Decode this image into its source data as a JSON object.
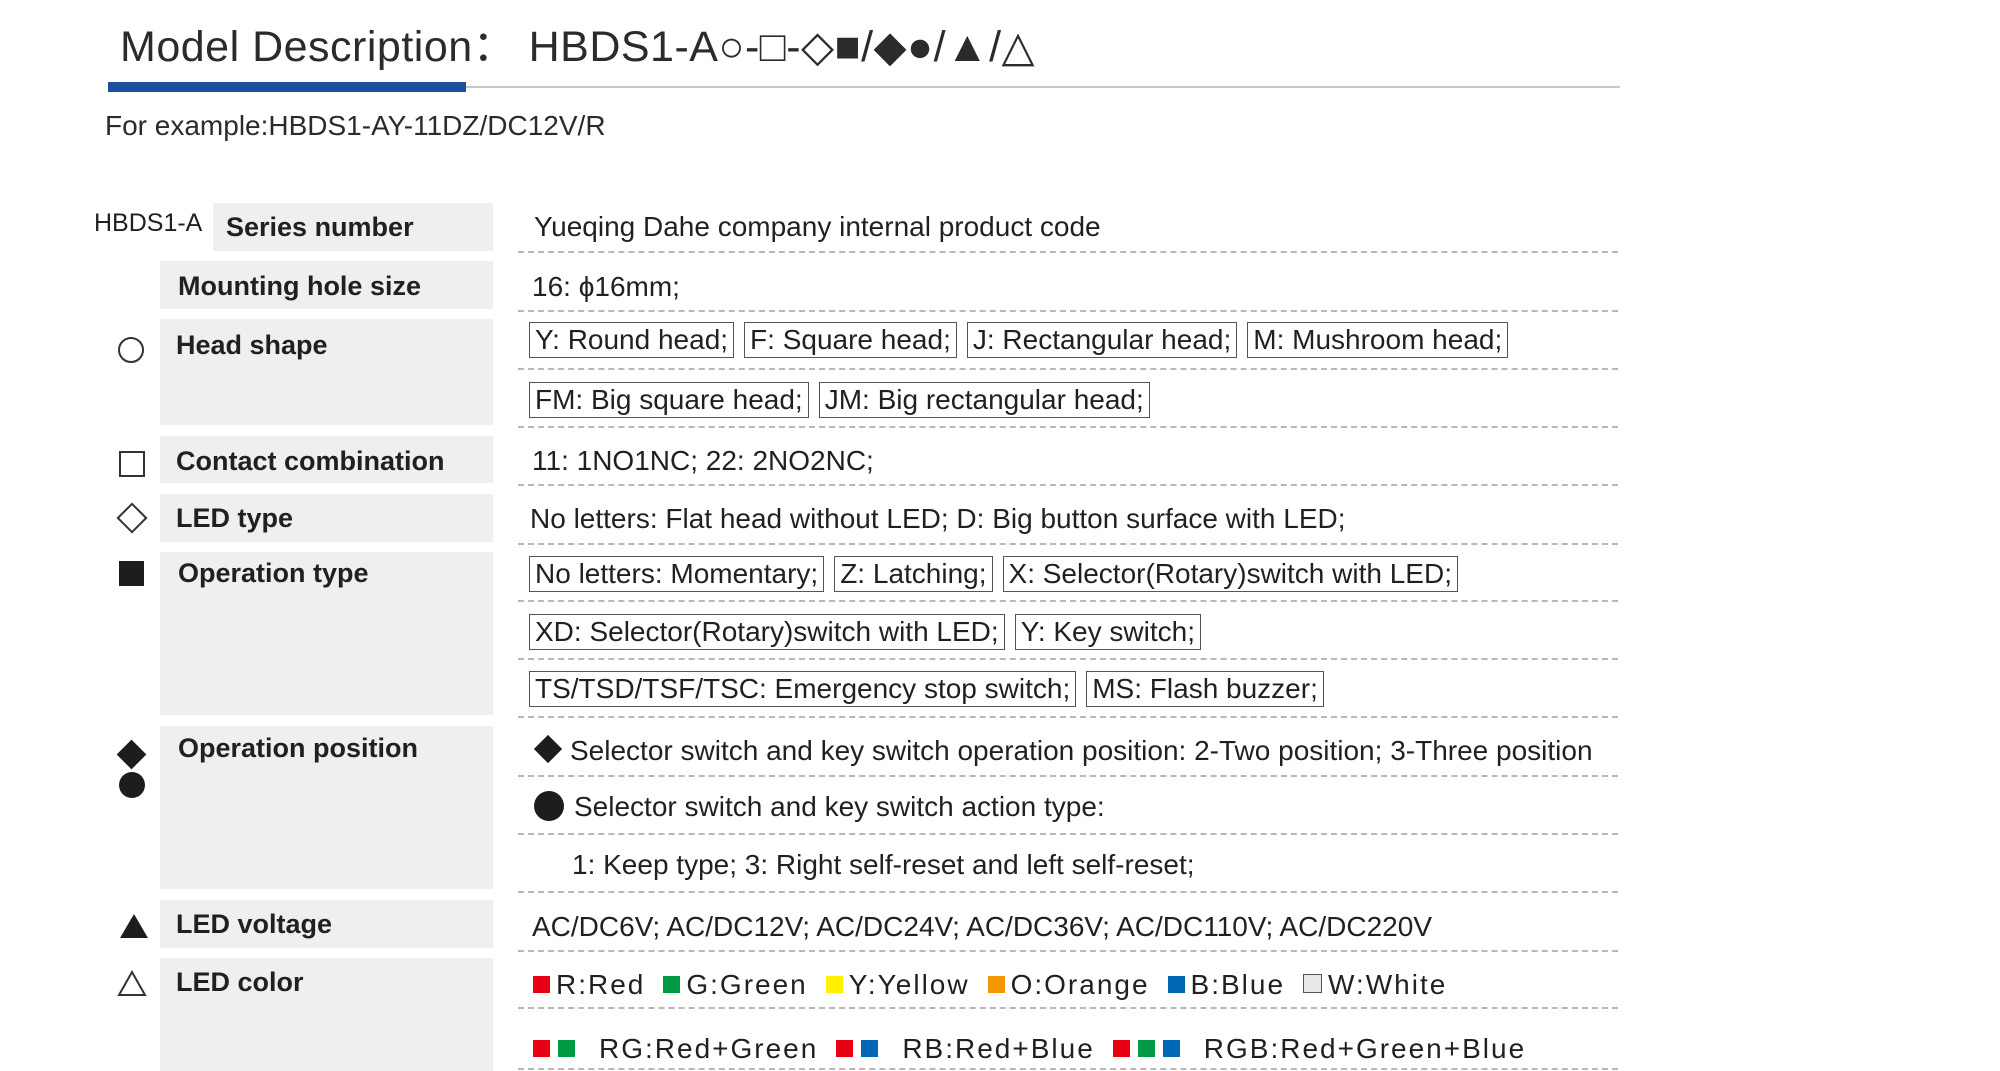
{
  "header": {
    "title": "Model Description： HBDS1-A○-□-◇■/◆●/▲/△",
    "example": "For example:HBDS1-AY-11DZ/DC12V/R"
  },
  "rows": {
    "series": {
      "code": "HBDS1-A",
      "label": "Series number",
      "value": "Yueqing Dahe company internal product code"
    },
    "mounting": {
      "label": "Mounting hole size",
      "value": "16: ϕ16mm;"
    },
    "head_shape": {
      "symbol_icon": "open-circle-icon",
      "label": "Head  shape",
      "line1": [
        "Y: Round head;",
        "F: Square head;",
        "J: Rectangular head;",
        "M: Mushroom head;"
      ],
      "line2": [
        "FM: Big square head;",
        "JM: Big rectangular head;"
      ]
    },
    "contact": {
      "symbol_icon": "open-square-icon",
      "label": "Contact combination",
      "value": "11: 1NO1NC;   22: 2NO2NC;"
    },
    "led_type": {
      "symbol_icon": "open-diamond-icon",
      "label": "LED type",
      "value": "No letters: Flat head without LED;   D: Big button surface with LED;"
    },
    "operation_type": {
      "symbol_icon": "filled-square-icon",
      "label": "Operation type",
      "line1": [
        "No letters: Momentary;",
        "Z: Latching;",
        "X: Selector(Rotary)switch with LED;"
      ],
      "line2": [
        "XD: Selector(Rotary)switch with LED;",
        "Y: Key switch;"
      ],
      "line3": [
        "TS/TSD/TSF/TSC: Emergency stop switch;",
        "MS: Flash buzzer;"
      ]
    },
    "operation_position": {
      "symbol_icons": [
        "filled-diamond-icon",
        "filled-circle-icon"
      ],
      "label": "Operation position",
      "line1": "Selector switch and key switch operation position: 2-Two position;   3-Three position",
      "line2": "Selector switch and key switch action type:",
      "line3": "1: Keep type;   3: Right self-reset and left self-reset;"
    },
    "led_voltage": {
      "symbol_icon": "filled-triangle-icon",
      "label": "LED voltage",
      "value": "AC/DC6V;   AC/DC12V;   AC/DC24V;   AC/DC36V;   AC/DC110V;   AC/DC220V"
    },
    "led_color": {
      "symbol_icon": "open-triangle-icon",
      "label": "LED color",
      "colors": [
        {
          "text": "R:Red",
          "color": "#e60012"
        },
        {
          "text": "G:Green",
          "color": "#009944"
        },
        {
          "text": "Y:Yellow",
          "color": "#fff100"
        },
        {
          "text": "O:Orange",
          "color": "#f39800"
        },
        {
          "text": "B:Blue",
          "color": "#0068b7"
        },
        {
          "text": "W:White",
          "color": "#e8e8e8"
        }
      ],
      "combos": [
        {
          "text": "RG:Red+Green",
          "colors": [
            "#e60012",
            "#009944"
          ]
        },
        {
          "text": "RB:Red+Blue",
          "colors": [
            "#e60012",
            "#0068b7"
          ]
        },
        {
          "text": "RGB:Red+Green+Blue",
          "colors": [
            "#e60012",
            "#009944",
            "#0068b7"
          ]
        }
      ]
    }
  }
}
